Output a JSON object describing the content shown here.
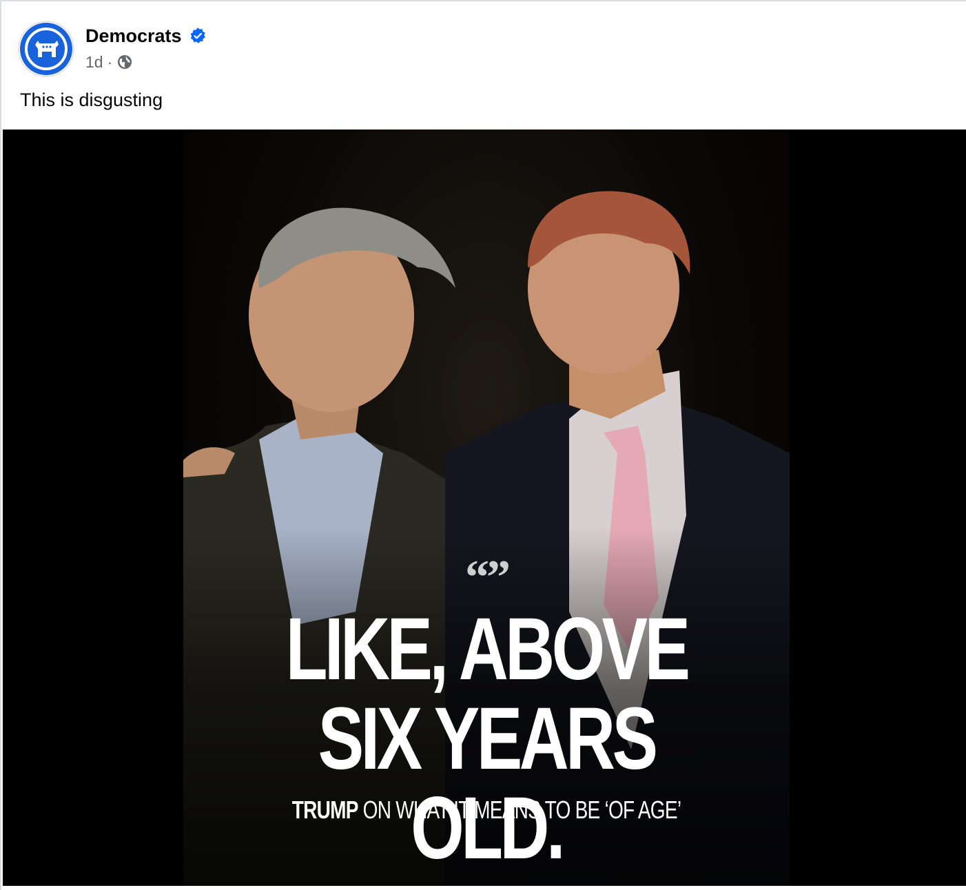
{
  "post": {
    "author": "Democrats",
    "timestamp": "1d",
    "separator": "·",
    "audience_icon": "globe-icon",
    "verified_icon": "verified-badge-icon",
    "avatar_icon": "donkey-logo-icon",
    "caption": "This is disgusting"
  },
  "image": {
    "quote_mark": "“”",
    "headline_line1": "LIKE, ABOVE",
    "headline_line2": "SIX YEARS OLD.",
    "subline_bold": "TRUMP",
    "subline_rest": " ON WHAT IT MEANS TO BE ‘OF AGE’"
  },
  "colors": {
    "brand_blue": "#1863dc",
    "verified_blue": "#0866ff",
    "text_primary": "#050505",
    "text_secondary": "#65676b",
    "image_background": "#000000"
  }
}
